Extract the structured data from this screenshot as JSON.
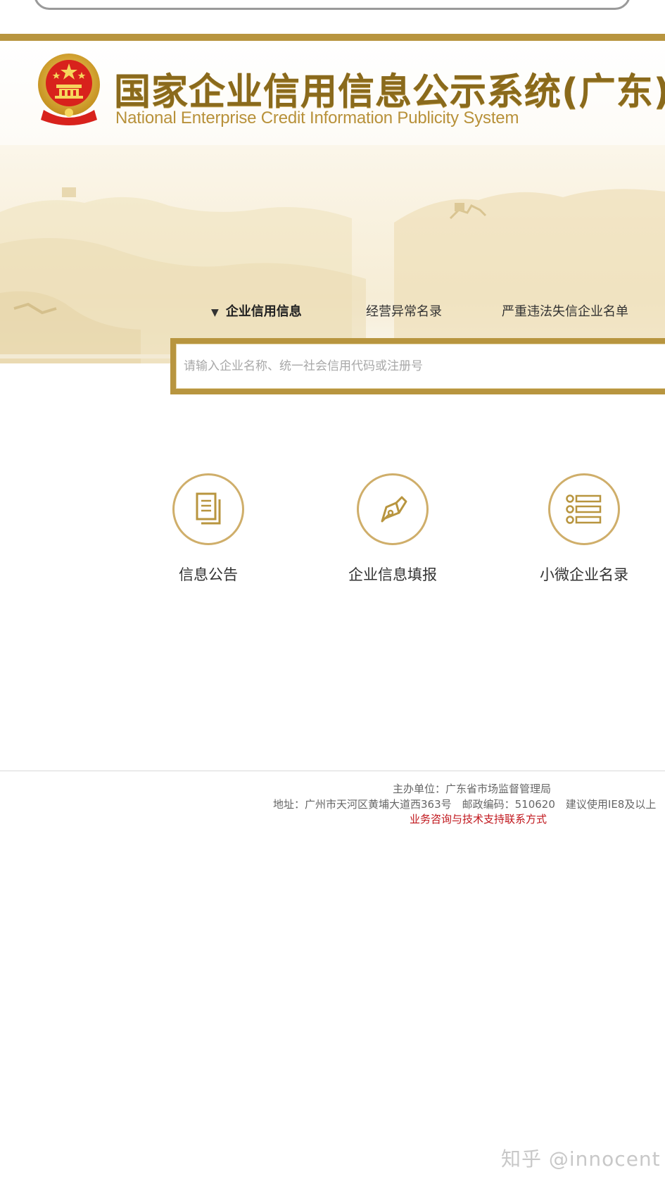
{
  "header": {
    "title_cn": "国家企业信用信息公示系统(广东)",
    "title_en": "National Enterprise Credit Information Publicity System"
  },
  "search": {
    "tabs": [
      {
        "label": "企业信用信息",
        "active": true
      },
      {
        "label": "经营异常名录",
        "active": false
      },
      {
        "label": "严重违法失信企业名单",
        "active": false
      }
    ],
    "placeholder": "请输入企业名称、统一社会信用代码或注册号"
  },
  "quick_links": [
    {
      "label": "信息公告",
      "icon": "document-icon"
    },
    {
      "label": "企业信息填报",
      "icon": "pen-nib-icon"
    },
    {
      "label": "小微企业名录",
      "icon": "list-icon"
    }
  ],
  "footer": {
    "sponsor": "主办单位：广东省市场监督管理局",
    "address": "地址：广州市天河区黄埔大道西363号　邮政编码：510620　建议使用IE8及以上",
    "contact_link": "业务咨询与技术支持联系方式"
  },
  "watermark": "知乎 @innocent",
  "colors": {
    "gold": "#b8953f",
    "title_brown": "#8a6a1c",
    "footer_link_red": "#c0161c"
  }
}
